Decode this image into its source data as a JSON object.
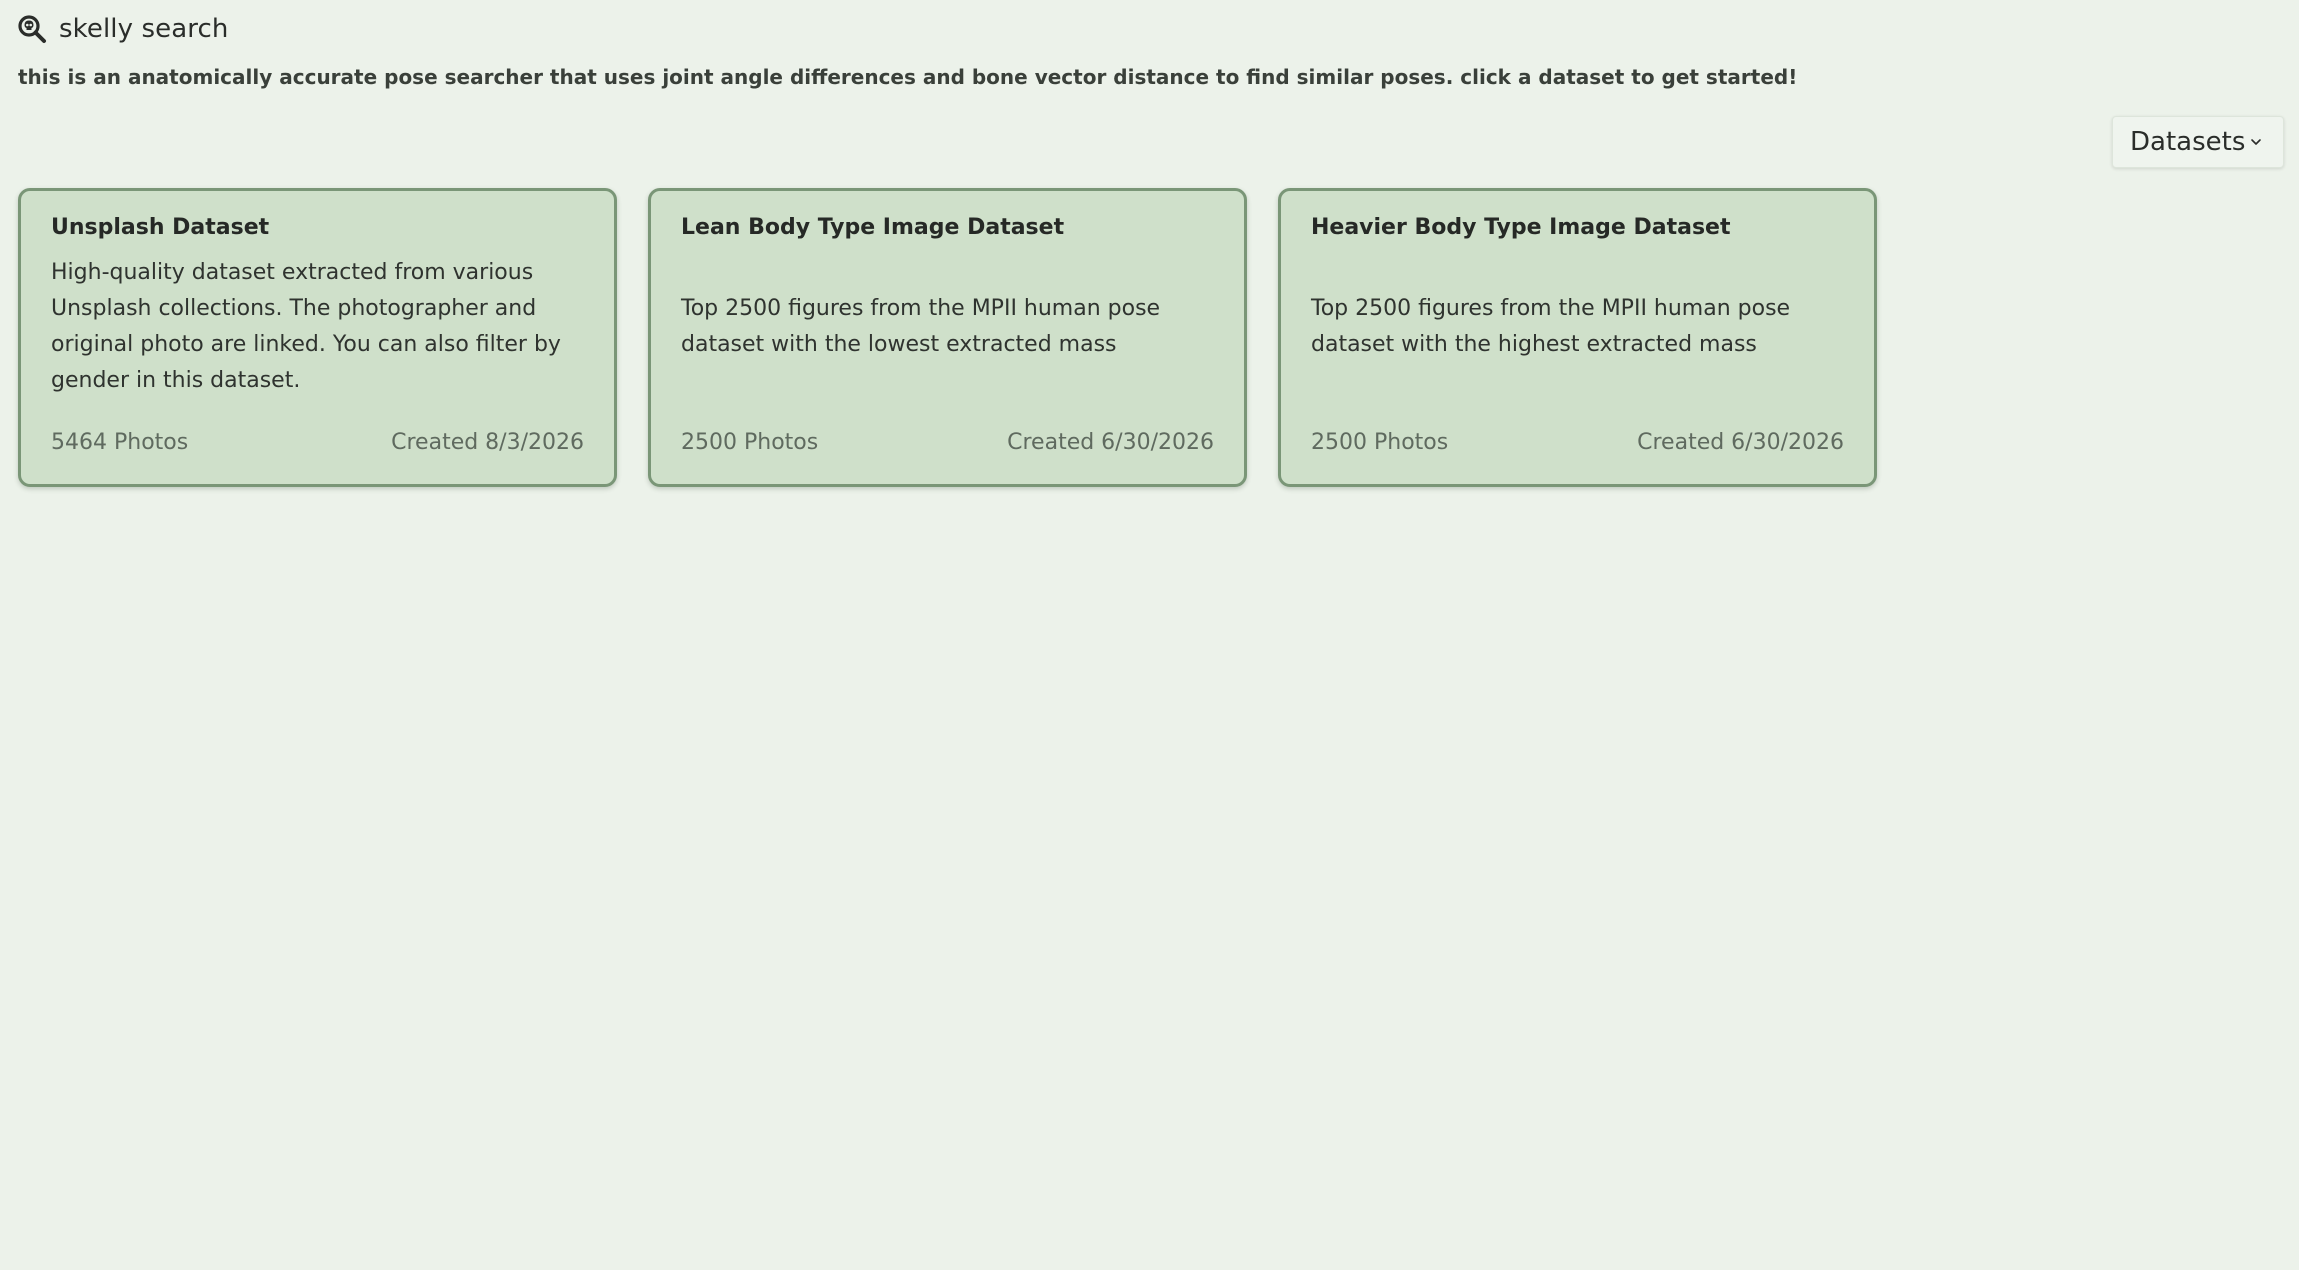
{
  "header": {
    "title": "skelly search",
    "icon": "magnifier-skull-icon",
    "tagline": "this is an anatomically accurate pose searcher that uses joint angle differences and bone vector distance to find similar poses. click a dataset to get started!"
  },
  "datasets_menu": {
    "label": "Datasets",
    "icon": "chevron-down-icon"
  },
  "colors": {
    "background": "#ecf2ea",
    "card_fill": "#cfe0ca",
    "card_border": "#7a9677"
  },
  "cards": [
    {
      "title": "Unsplash Dataset",
      "description": "High-quality dataset extracted from various Unsplash collections. The photographer and original photo are linked. You can also filter by gender in this dataset.",
      "count": "5464 Photos",
      "created": "Created 8/3/2026"
    },
    {
      "title": "Lean Body Type Image Dataset",
      "description": "Top 2500 figures from the MPII human pose dataset with the lowest extracted mass",
      "count": "2500 Photos",
      "created": "Created 6/30/2026"
    },
    {
      "title": "Heavier Body Type Image Dataset",
      "description": "Top 2500 figures from the MPII human pose dataset with the highest extracted mass",
      "count": "2500 Photos",
      "created": "Created 6/30/2026"
    }
  ]
}
